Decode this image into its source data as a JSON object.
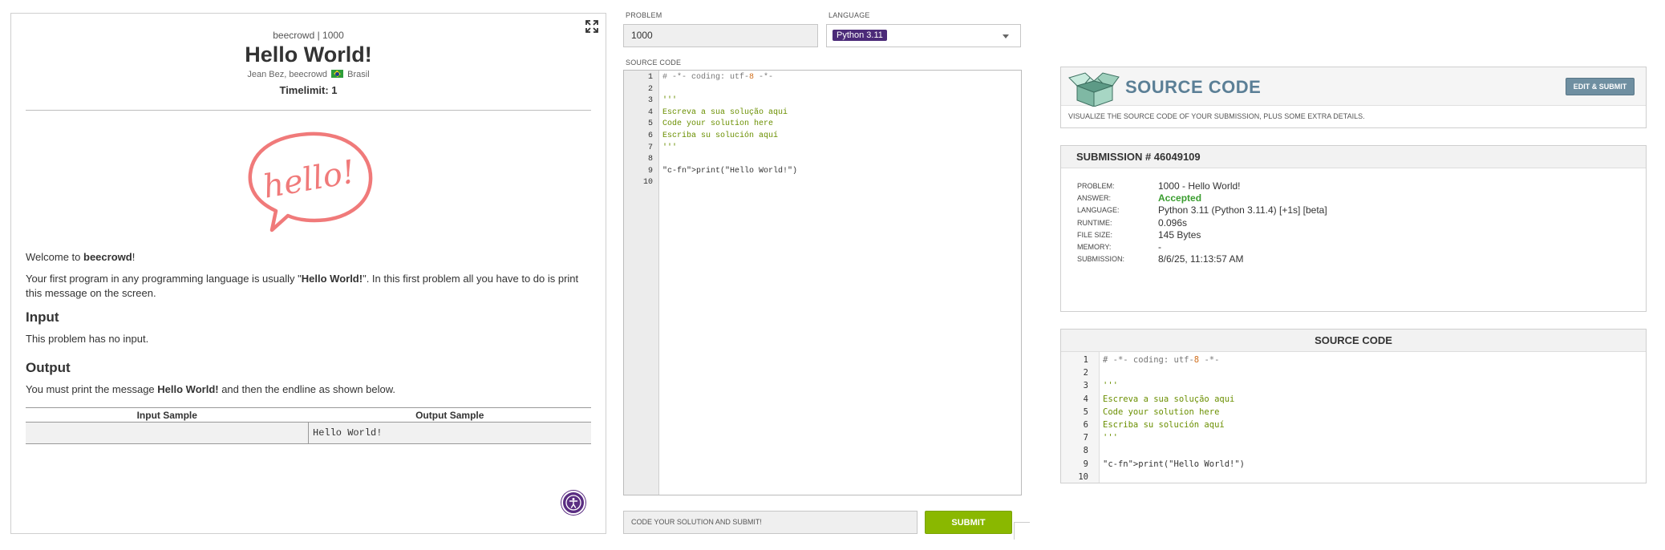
{
  "problem": {
    "source": "beecrowd | 1000",
    "title": "Hello World!",
    "author": "Jean Bez, beecrowd",
    "country": "Brasil",
    "timelimit": "Timelimit: 1",
    "image_text": "hello!",
    "welcome_prefix": "Welcome to ",
    "welcome_bold": "beecrowd",
    "welcome_suffix": "!",
    "desc_prefix": "Your first program in any programming language is usually \"",
    "desc_bold": "Hello World!",
    "desc_suffix": "\". In this first problem all you have to do is print this message on the screen.",
    "input_heading": "Input",
    "input_text": "This problem has no input.",
    "output_heading": "Output",
    "output_prefix": "You must print the message ",
    "output_bold": "Hello World!",
    "output_suffix": " and then the endline as shown below.",
    "sample_headers": [
      "Input Sample",
      "Output Sample"
    ],
    "sample_input": "",
    "sample_output": "Hello World!"
  },
  "editor": {
    "problem_label": "PROBLEM",
    "problem_value": "1000",
    "language_label": "LANGUAGE",
    "language_value": "Python 3.11",
    "source_label": "SOURCE CODE",
    "line_numbers": [
      "1",
      "2",
      "3",
      "4",
      "5",
      "6",
      "7",
      "8",
      "9",
      "10"
    ],
    "code_lines": [
      "# -*- coding: utf-8 -*-",
      "",
      "'''",
      "Escreva a sua solução aqui",
      "Code your solution here",
      "Escriba su solución aquí",
      "'''",
      "",
      "print(\"Hello World!\")",
      ""
    ],
    "submit_placeholder": "CODE YOUR SOLUTION AND SUBMIT!",
    "submit_label": "SUBMIT"
  },
  "source_header": {
    "title": "SOURCE CODE",
    "edit_submit_label": "EDIT & SUBMIT",
    "description": "VISUALIZE THE SOURCE CODE OF YOUR SUBMISSION, PLUS SOME EXTRA DETAILS."
  },
  "submission": {
    "heading": "SUBMISSION # 46049109",
    "rows": [
      {
        "key": "PROBLEM:",
        "value": "1000 - Hello World!"
      },
      {
        "key": "ANSWER:",
        "value": "Accepted"
      },
      {
        "key": "LANGUAGE:",
        "value": "Python 3.11 (Python 3.11.4) [+1s] [beta]"
      },
      {
        "key": "RUNTIME:",
        "value": "0.096s"
      },
      {
        "key": "FILE SIZE:",
        "value": "145 Bytes"
      },
      {
        "key": "MEMORY:",
        "value": "-"
      },
      {
        "key": "SUBMISSION:",
        "value": "8/6/25, 11:13:57 AM"
      }
    ]
  },
  "source_view": {
    "heading": "SOURCE CODE"
  },
  "colors": {
    "accent_green": "#8ab800",
    "language_badge": "#4b2a78",
    "accepted": "#3a9d2f",
    "brand_blue": "#5b7f96",
    "hello_coral": "#f07a7a"
  }
}
